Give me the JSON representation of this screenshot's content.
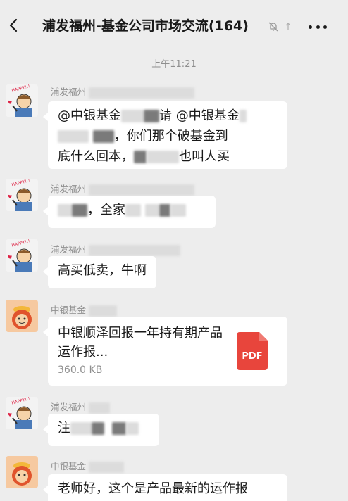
{
  "header": {
    "back_icon": "chevron-left-icon",
    "title": "浦发福州-基金公司市场交流(164)",
    "mute_icon": "bell-off-icon",
    "more_icon": "more-dots-icon"
  },
  "timestamp": "上午11:21",
  "messages": [
    {
      "sender": "浦发福州",
      "lines": [
        "@中银基金",
        "请 @中银基金",
        "，你们那个破基金到",
        "底什么回本，",
        "也叫人买"
      ]
    },
    {
      "sender": "浦发福州",
      "lines": [
        "，全家"
      ]
    },
    {
      "sender": "浦发福州",
      "text": "高买低卖，牛啊"
    },
    {
      "sender": "中银基金",
      "file": {
        "name": "中银顺泽回报一年持有期产品运作报...",
        "size": "360.0 KB",
        "type": "PDF"
      }
    },
    {
      "sender": "浦发福州",
      "lines": [
        "注"
      ]
    },
    {
      "sender": "中银基金",
      "text": "老师好，这个是产品最新的运作报"
    }
  ],
  "colors": {
    "background": "#ededed",
    "bubble": "#ffffff",
    "pdf": "#e8453c",
    "meta_text": "#8f8f8f"
  }
}
